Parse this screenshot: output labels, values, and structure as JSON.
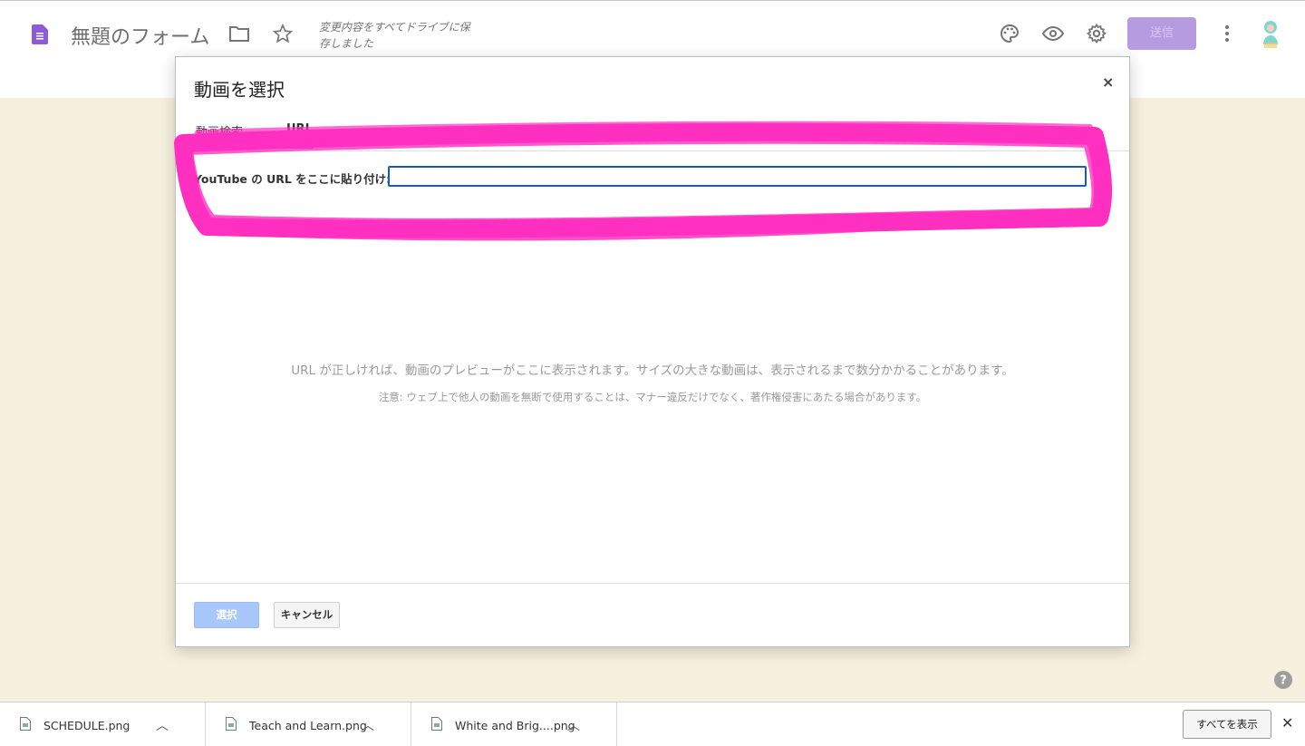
{
  "app": {
    "form_title": "無題のフォーム",
    "save_status": "変更内容をすべてドライブに保存しました",
    "send_label": "送信"
  },
  "icons": {
    "palette": "palette-icon",
    "preview": "eye-icon",
    "settings": "gear-icon",
    "more": "more-vert-icon"
  },
  "dialog": {
    "title": "動画を選択",
    "close": "×",
    "tabs": [
      {
        "label": "動画検索",
        "active": false
      },
      {
        "label": "URL",
        "active": true
      }
    ],
    "url_label": "YouTube の URL をここに貼り付け:",
    "url_value": "",
    "preview_message": "URL が正しければ、動画のプレビューがここに表示されます。サイズの大きな動画は、表示されるまで数分かかることがあります。",
    "warning_message": "注意: ウェブ上で他人の動画を無断で使用することは、マナー違反だけでなく、著作権侵害にあたる場合があります。",
    "select_label": "選択",
    "cancel_label": "キャンセル"
  },
  "downloads": {
    "items": [
      {
        "name": "SCHEDULE.png"
      },
      {
        "name": "Teach and Learn.png"
      },
      {
        "name": "White and Brig....png"
      }
    ],
    "show_all_label": "すべてを表示",
    "close": "✕"
  },
  "colors": {
    "accent": "#673ab7",
    "highlight": "#ff2fc0",
    "background": "#f6f0de"
  }
}
